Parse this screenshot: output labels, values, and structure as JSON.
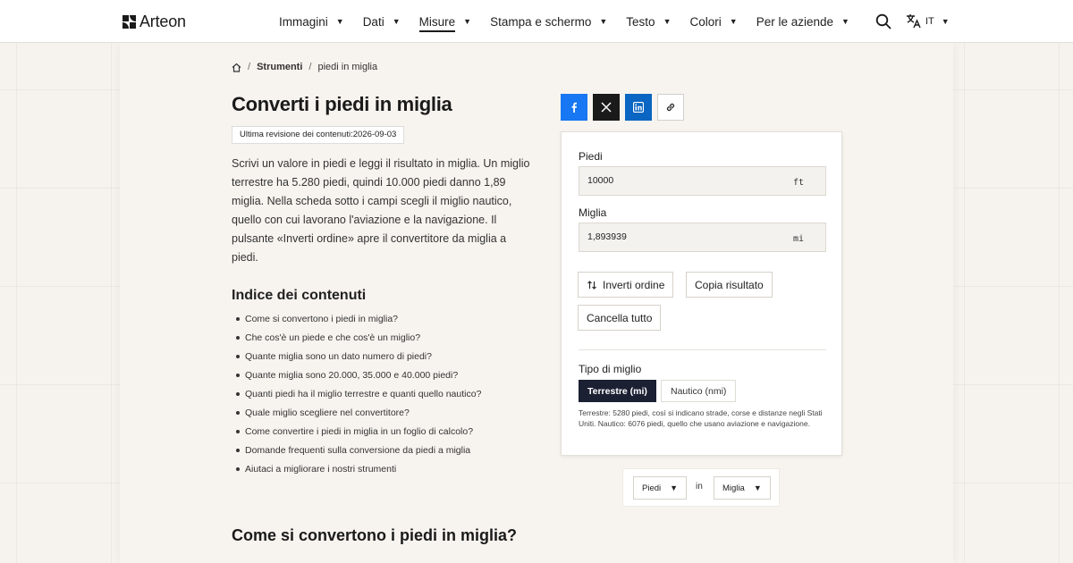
{
  "brand": {
    "name": "Arteon"
  },
  "nav": {
    "items": [
      {
        "label": "Immagini",
        "active": false
      },
      {
        "label": "Dati",
        "active": false
      },
      {
        "label": "Misure",
        "active": true
      },
      {
        "label": "Stampa e schermo",
        "active": false
      },
      {
        "label": "Testo",
        "active": false
      },
      {
        "label": "Colori",
        "active": false
      },
      {
        "label": "Per le aziende",
        "active": false
      }
    ],
    "language": "IT"
  },
  "breadcrumb": {
    "section": "Strumenti",
    "current": "piedi in miglia"
  },
  "page": {
    "title": "Converti i piedi in miglia",
    "revision": "Ultima revisione dei contenuti:2026-09-03",
    "intro": "Scrivi un valore in piedi e leggi il risultato in miglia. Un miglio terrestre ha 5.280 piedi, quindi 10.000 piedi danno 1,89 miglia. Nella scheda sotto i campi scegli il miglio nautico, quello con cui lavorano l'aviazione e la navigazione. Il pulsante «Inverti ordine» apre il convertitore da miglia a piedi.",
    "toc_title": "Indice dei contenuti",
    "toc": [
      "Come si convertono i piedi in miglia?",
      "Che cos'è un piede e che cos'è un miglio?",
      "Quante miglia sono un dato numero di piedi?",
      "Quante miglia sono 20.000, 35.000 e 40.000 piedi?",
      "Quanti piedi ha il miglio terrestre e quanti quello nautico?",
      "Quale miglio scegliere nel convertitore?",
      "Come convertire i piedi in miglia in un foglio di calcolo?",
      "Domande frequenti sulla conversione da piedi a miglia",
      "Aiutaci a migliorare i nostri strumenti"
    ],
    "section_heading": "Come si convertono i piedi in miglia?"
  },
  "converter": {
    "from_label": "Piedi",
    "from_value": "10000",
    "from_unit": "ft",
    "to_label": "Miglia",
    "to_value": "1,893939",
    "to_unit": "mi",
    "swap_label": "Inverti ordine",
    "copy_label": "Copia risultato",
    "clear_label": "Cancella tutto",
    "type_label": "Tipo di miglio",
    "type_options": [
      "Terrestre (mi)",
      "Nautico (nmi)"
    ],
    "type_selected": "Terrestre (mi)",
    "note": "Terrestre: 5280 piedi, così si indicano strade, corse e distanze negli Stati Uniti. Nautico: 6076 piedi, quello che usano aviazione e navigazione."
  },
  "switcher": {
    "from": "Piedi",
    "connector": "in",
    "to": "Miglia"
  },
  "colors": {
    "accent_dark": "#1c2033",
    "facebook": "#1877f2",
    "linkedin": "#0a66c2",
    "x": "#1a1a1a"
  },
  "icons": [
    "home-icon",
    "search-icon",
    "translate-icon",
    "facebook-icon",
    "x-icon",
    "linkedin-icon",
    "link-icon",
    "swap-icon"
  ]
}
